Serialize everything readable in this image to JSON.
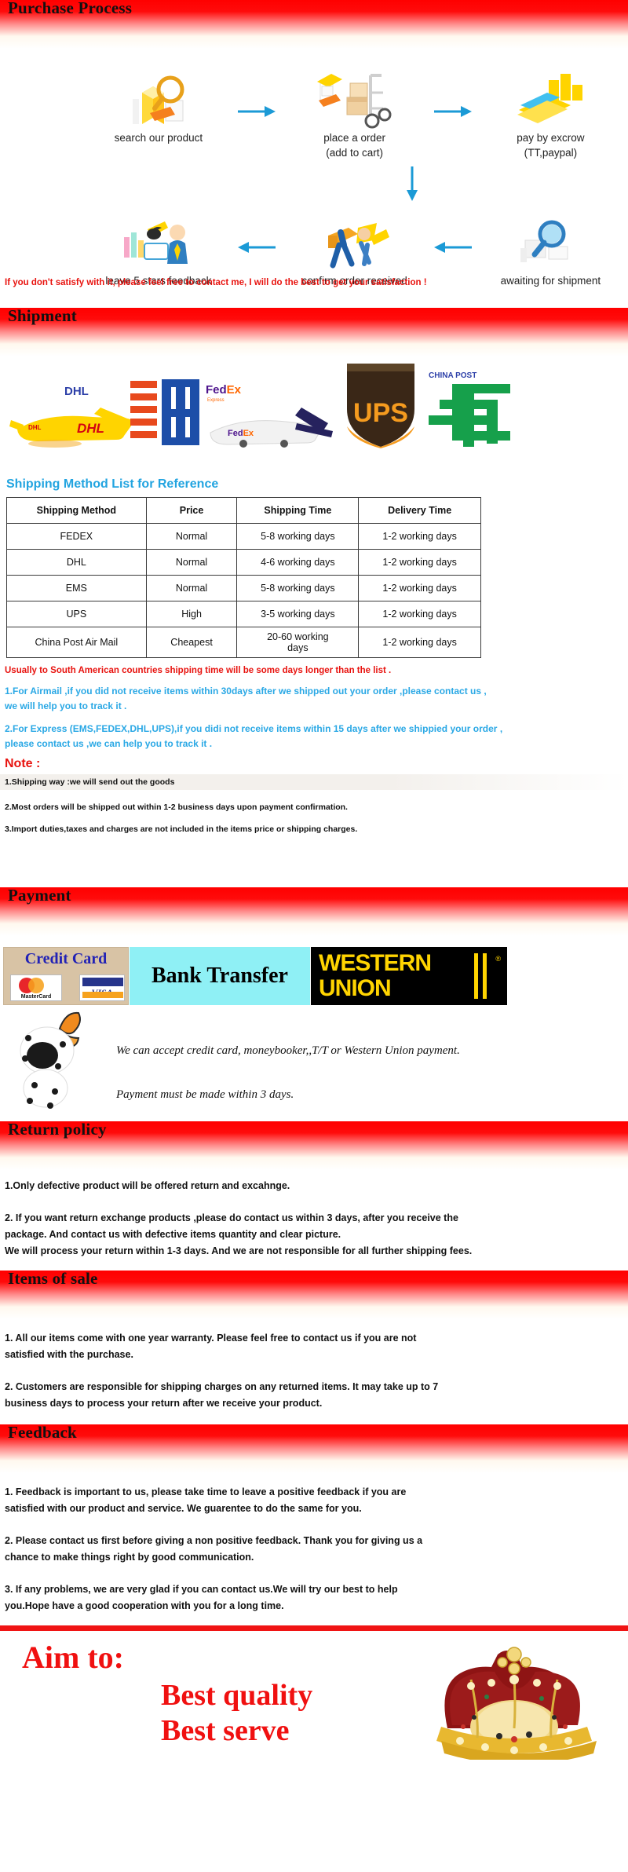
{
  "sections": {
    "purchase": "Purchase Process",
    "shipment": "Shipment",
    "payment": "Payment",
    "return": "Return policy",
    "items": "Items of sale",
    "feedback": "Feedback"
  },
  "purchase_process": {
    "steps_top": [
      {
        "label1": "search our product",
        "label2": ""
      },
      {
        "label1": "place a order",
        "label2": "(add to cart)"
      },
      {
        "label1": "pay by excrow",
        "label2": "(TT,paypal)"
      }
    ],
    "steps_bottom": [
      {
        "label1": "leave 5 stars feedback",
        "label2": ""
      },
      {
        "label1": "confirm order received",
        "label2": ""
      },
      {
        "label1": "awaiting for shipment",
        "label2": ""
      }
    ],
    "satisfy_note": "If  you don't satisfy with it, please feel free to contact me, I will do the best to get your satisfaction !"
  },
  "shipment": {
    "carriers": [
      "DHL",
      "EMS",
      "FedEx",
      "UPS",
      "CHINA POST"
    ],
    "table_title": "Shipping Method List for Reference",
    "table": {
      "headers": [
        "Shipping Method",
        "Price",
        "Shipping Time",
        "Delivery Time"
      ],
      "rows": [
        [
          "FEDEX",
          "Normal",
          "5-8 working days",
          "1-2 working days"
        ],
        [
          "DHL",
          "Normal",
          "4-6 working days",
          "1-2 working days"
        ],
        [
          "EMS",
          "Normal",
          "5-8 working days",
          "1-2 working days"
        ],
        [
          "UPS",
          "High",
          "3-5 working days",
          "1-2 working days"
        ],
        [
          "China Post Air Mail",
          "Cheapest",
          "20-60 working days",
          "1-2 working days"
        ]
      ]
    },
    "south_america_note": "Usually to South American countries shipping time will be some days longer than the list .",
    "airmail_note_l1": "1.For Airmail ,if you did not receive items within 30days after we shipped out your order ,please contact us ,",
    "airmail_note_l2": "we will help you to track it .",
    "express_note_l1": "2.For Express (EMS,FEDEX,DHL,UPS),if you didi not receive items within 15 days after we shippied your order ,",
    "express_note_l2": "please contact us ,we can help you to track it .",
    "note_heading": "Note :",
    "notes": [
      "1.Shipping way :we will send out the goods",
      "2.Most orders will be shipped out within 1-2 business days upon payment confirmation.",
      "3.Import duties,taxes and charges are not included in the items price or shipping charges."
    ]
  },
  "payment": {
    "credit_card_label": "Credit Card",
    "mastercard_label": "MasterCard",
    "visa_label": "VISA",
    "bank_transfer_label": "Bank Transfer",
    "western_label": "WESTERN",
    "union_label": "UNION",
    "accept_text": "We can accept credit card, moneybooker,,T/T or Western Union payment.",
    "within_text": "Payment must be made within 3 days."
  },
  "return_policy": {
    "lines": [
      "1.Only defective product will be offered return and excahnge.",
      "2. If you want return exchange products ,please do contact us within 3 days, after you receive the",
      "package. And contact us with defective items quantity and clear picture.",
      "We will process your return within 1-3 days. And we are not responsible for all further shipping fees."
    ]
  },
  "items_of_sale": {
    "lines": [
      "1. All our items come with one year warranty. Please feel free to contact us if you are not",
      "satisfied with the purchase.",
      "2. Customers are responsible for shipping charges on any returned items. It may take up to 7",
      "business days to process your return after we receive your product."
    ]
  },
  "feedback": {
    "lines": [
      "1. Feedback is important to us, please take time to leave a positive feedback if you are",
      "satisfied with our product and service. We guarentee to do the same for you.",
      "2. Please contact us first before giving a non positive feedback. Thank you for giving us a",
      "chance to make things right by good communication.",
      "3. If any problems, we are very glad if you can contact us.We will try our best to help",
      "you.Hope have a good cooperation with you for a long time."
    ]
  },
  "footer": {
    "aim_to": "Aim to:",
    "best_quality": "Best quality",
    "best_serve": "Best serve"
  },
  "colors": {
    "banner_red": "#ff0000",
    "accent_blue": "#22a4e0",
    "alert_red": "#e8130f",
    "arrow_blue": "#1b9ad6"
  }
}
